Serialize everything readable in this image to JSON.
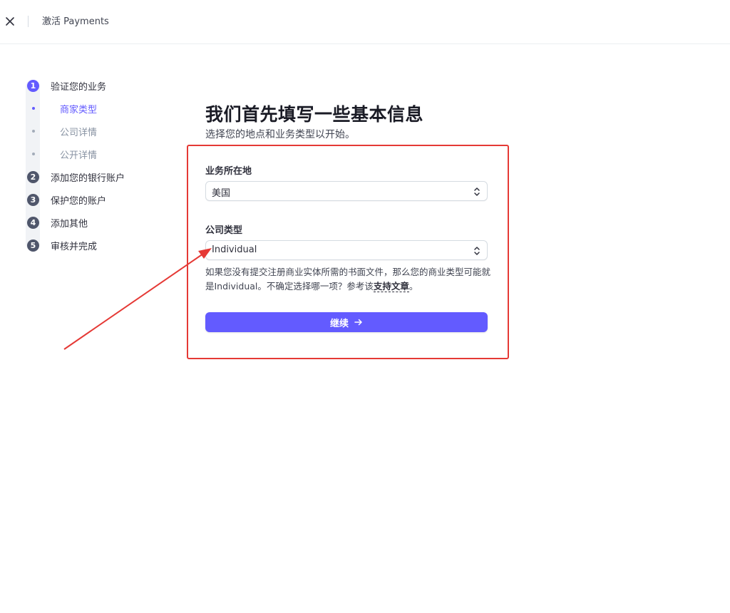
{
  "topbar": {
    "title": "激活 Payments",
    "close_icon": "close-icon"
  },
  "stepper": {
    "steps": [
      {
        "number": "1",
        "label": "验证您的业务",
        "active": true
      },
      {
        "number": "2",
        "label": "添加您的银行账户",
        "active": false
      },
      {
        "number": "3",
        "label": "保护您的账户",
        "active": false
      },
      {
        "number": "4",
        "label": "添加其他",
        "active": false
      },
      {
        "number": "5",
        "label": "审核并完成",
        "active": false
      }
    ],
    "substeps": [
      {
        "label": "商家类型",
        "active": true
      },
      {
        "label": "公司详情",
        "active": false
      },
      {
        "label": "公开详情",
        "active": false
      }
    ]
  },
  "main": {
    "title": "我们首先填写一些基本信息",
    "subtitle": "选择您的地点和业务类型以开始。",
    "location": {
      "label": "业务所在地",
      "value": "美国"
    },
    "company_type": {
      "label": "公司类型",
      "value": "Individual"
    },
    "help": {
      "text": "如果您没有提交注册商业实体所需的书面文件，那么您的商业类型可能就是Individual。不确定选择哪一项？参考该",
      "link": "支持文章",
      "suffix": "。"
    },
    "continue_label": "继续"
  },
  "colors": {
    "accent": "#635bff",
    "highlight": "#e53935"
  }
}
